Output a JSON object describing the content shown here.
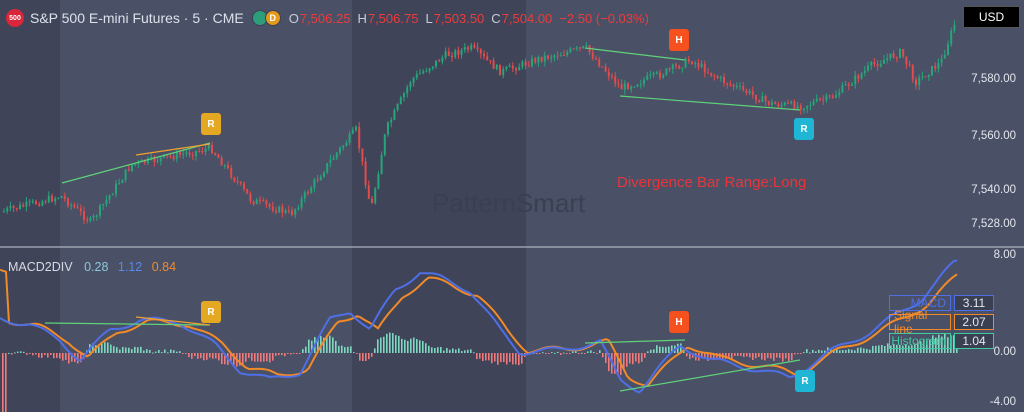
{
  "header": {
    "exchange_badge": "500",
    "symbol": "S&P 500 E-mini Futures · 5 · CME",
    "open_label": "O",
    "open": "7,506.25",
    "high_label": "H",
    "high": "7,506.75",
    "low_label": "L",
    "low": "7,503.50",
    "close_label": "C",
    "close": "7,504.00",
    "change": "−2.50 (−0.03%)",
    "g_badge": "G",
    "d_badge": "D"
  },
  "currency": "USD",
  "indicator": {
    "name": "MACD2DIV",
    "v1": "0.28",
    "v2": "1.12",
    "v3": "0.84"
  },
  "price_axis": [
    "7,580.00",
    "7,560.00",
    "7,540.00",
    "7,528.00"
  ],
  "macd_axis": [
    "8.00",
    "0.00",
    "-4.00"
  ],
  "watermark": "PatternSmart",
  "divergence_text": "Divergence Bar Range:Long",
  "markers": [
    {
      "label": "R",
      "color": "#e5a823"
    },
    {
      "label": "H",
      "color": "#f4511e"
    },
    {
      "label": "R",
      "color": "#1fb6d6"
    },
    {
      "label": "R",
      "color": "#e5a823"
    },
    {
      "label": "H",
      "color": "#f4511e"
    },
    {
      "label": "R",
      "color": "#1fb6d6"
    }
  ],
  "legend": [
    {
      "name": "MACD",
      "value": "3.11",
      "color": "#4f6fe6"
    },
    {
      "name": "Signal line",
      "value": "2.07",
      "color": "#f08a2a"
    },
    {
      "name": "Histogram",
      "value": "1.04",
      "color": "#3ec9a0"
    }
  ],
  "colors": {
    "up": "#27a57a",
    "down": "#e24c4c",
    "macd": "#4f6fe6",
    "signal": "#f08a2a",
    "divergence_line": "#5fd37a",
    "panel_bg": "#4a5066",
    "shade": "#3f4459"
  }
}
